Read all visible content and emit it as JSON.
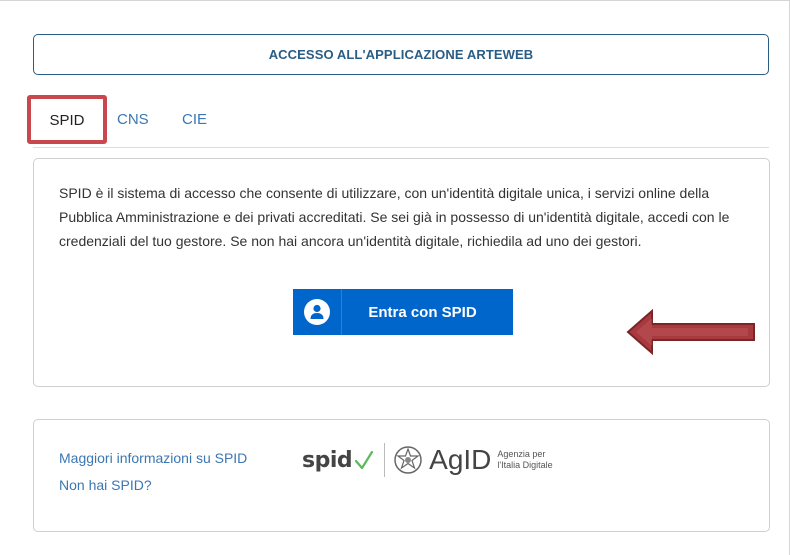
{
  "header": {
    "title": "ACCESSO ALL'APPLICAZIONE ARTEWEB"
  },
  "tabs": [
    {
      "label": "SPID",
      "selected": true
    },
    {
      "label": "CNS"
    },
    {
      "label": "CIE"
    }
  ],
  "spid_panel": {
    "description": "SPID è il sistema di accesso che consente di utilizzare, con un'identità digitale unica, i servizi online della Pubblica Amministrazione e dei privati accreditati. Se sei già in possesso di un'identità digitale, accedi con le credenziali del tuo gestore. Se non hai ancora un'identità digitale, richiedila ad uno dei gestori.",
    "button_label": "Entra con SPID",
    "button_icon": "user-icon"
  },
  "footer": {
    "links": [
      {
        "label": "Maggiori informazioni su SPID"
      },
      {
        "label": "Non hai SPID?"
      }
    ],
    "logos": {
      "spid": "spid",
      "agid": "AgID",
      "agid_sub_1": "Agenzia per",
      "agid_sub_2": "l'Italia Digitale"
    }
  },
  "colors": {
    "accent_blue": "#0066cc",
    "link_blue": "#3b77b2",
    "highlight_red": "#c9484d",
    "arrow_red": "#a83a3f"
  }
}
